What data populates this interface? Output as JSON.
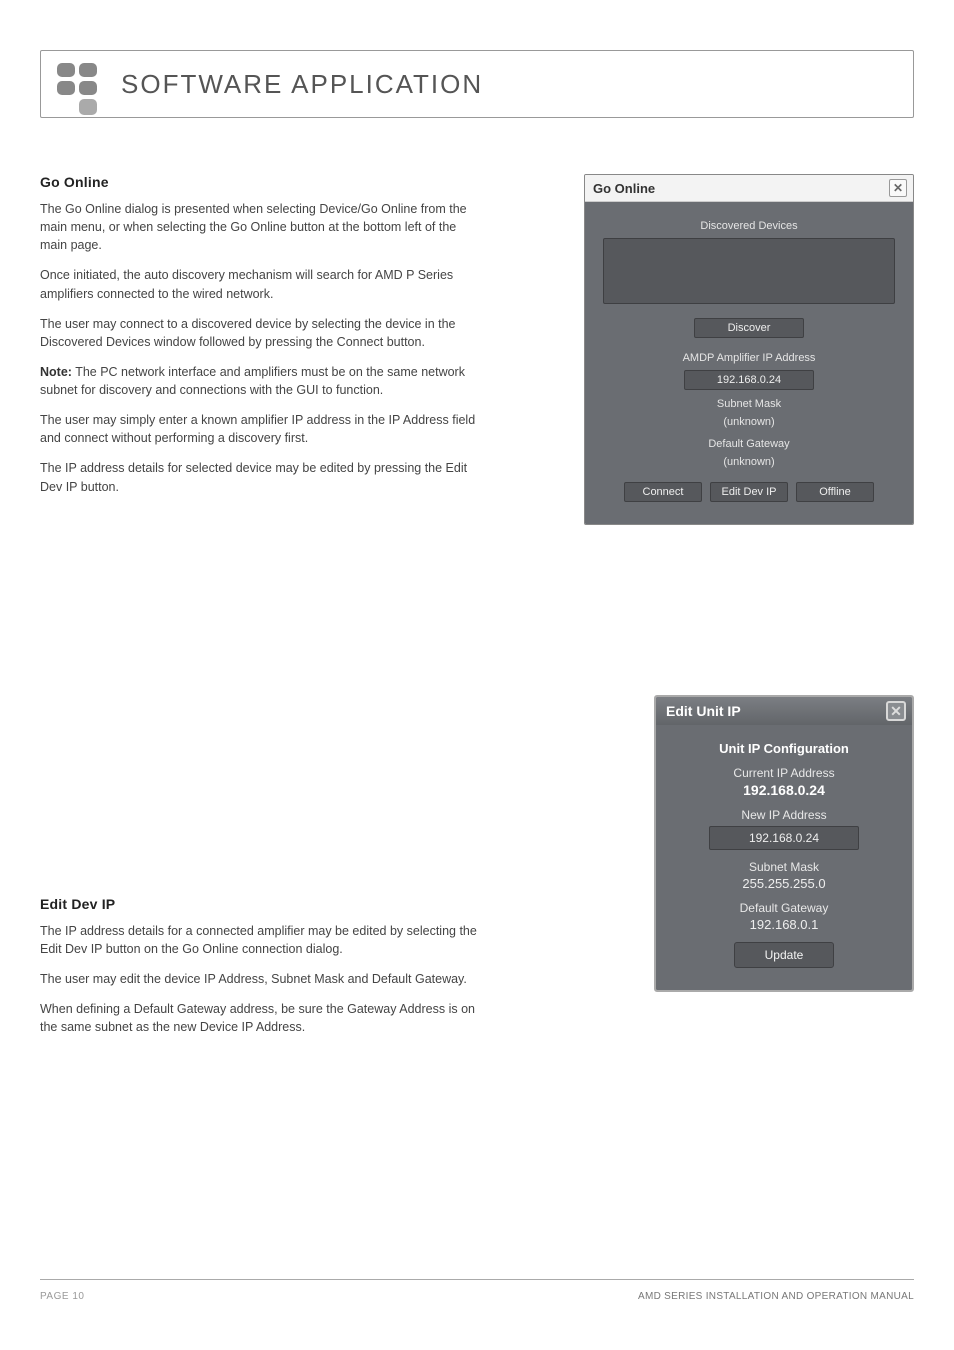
{
  "header": {
    "title": "SOFTWARE APPLICATION"
  },
  "sec1": {
    "heading": "Go Online",
    "p1": "The Go Online dialog is presented when selecting Device/Go Online from the main menu, or when selecting the Go Online button at the bottom left of the main page.",
    "p2": "Once initiated, the auto discovery mechanism will search for AMD P Series amplifiers connected to the wired network.",
    "p3": "The user may connect to a discovered device by selecting the device in the Discovered Devices window followed by pressing the Connect button.",
    "note_label": "Note:",
    "p4": "  The PC network interface and amplifiers must be on the same network subnet for discovery and connections with the GUI to function.",
    "p5": "The user may simply enter a known amplifier IP address in the IP Address field and connect without performing a discovery first.",
    "p6": "The IP address details for selected device may be edited by pressing the Edit Dev IP button."
  },
  "dlg1": {
    "title": "Go Online",
    "discovered_label": "Discovered Devices",
    "discover_btn": "Discover",
    "ip_label": "AMDP Amplifier IP Address",
    "ip_value": "192.168.0.24",
    "subnet_label": "Subnet Mask",
    "subnet_value": "(unknown)",
    "gw_label": "Default Gateway",
    "gw_value": "(unknown)",
    "connect_btn": "Connect",
    "edit_btn": "Edit Dev IP",
    "offline_btn": "Offline"
  },
  "sec2": {
    "heading": "Edit Dev IP",
    "p1": "The IP address details for a connected amplifier may be edited by selecting the Edit Dev IP button on the Go Online connection dialog.",
    "p2": "The user may edit the device IP Address, Subnet Mask and Default Gateway.",
    "p3": "When defining a Default Gateway address, be sure the Gateway Address is on the same subnet as the new Device IP Address."
  },
  "dlg2": {
    "title": "Edit Unit IP",
    "cfg_heading": "Unit IP Configuration",
    "cur_label": "Current IP Address",
    "cur_value": "192.168.0.24",
    "new_label": "New IP Address",
    "new_value": "192.168.0.24",
    "subnet_label": "Subnet Mask",
    "subnet_value": "255.255.255.0",
    "gw_label": "Default Gateway",
    "gw_value": "192.168.0.1",
    "update_btn": "Update"
  },
  "footer": {
    "left": "PAGE 10",
    "right": "AMD SERIES INSTALLATION AND OPERATION MANUAL"
  }
}
